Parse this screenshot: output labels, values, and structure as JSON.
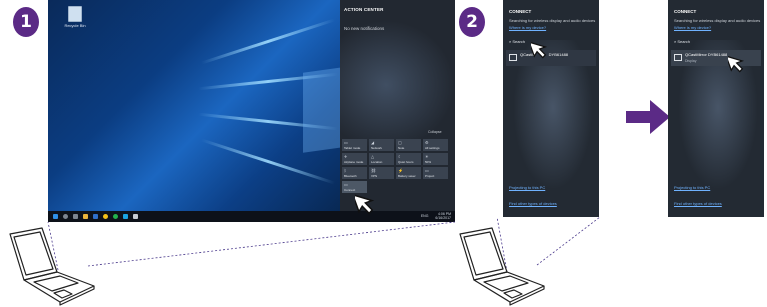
{
  "steps": {
    "one": "1",
    "two": "2"
  },
  "desktop": {
    "recycle_label": "Recycle Bin",
    "taskbar_time": "4:06 PM",
    "taskbar_date": "6/16/2017",
    "taskbar_lang": "ENG"
  },
  "action_center": {
    "title": "ACTION CENTER",
    "no_notifications": "No new notifications",
    "collapse": "Collapse",
    "tiles": [
      {
        "label": "Tablet mode",
        "icon": "tablet-mode-icon"
      },
      {
        "label": "Network",
        "icon": "network-icon"
      },
      {
        "label": "Note",
        "icon": "note-icon"
      },
      {
        "label": "All settings",
        "icon": "settings-icon"
      },
      {
        "label": "Airplane mode",
        "icon": "airplane-icon"
      },
      {
        "label": "Location",
        "icon": "location-icon"
      },
      {
        "label": "Quiet hours",
        "icon": "quiet-hours-icon"
      },
      {
        "label": "50%",
        "icon": "brightness-icon"
      },
      {
        "label": "Bluetooth",
        "icon": "bluetooth-icon"
      },
      {
        "label": "VPN",
        "icon": "vpn-icon"
      },
      {
        "label": "Battery saver",
        "icon": "battery-saver-icon"
      },
      {
        "label": "Project",
        "icon": "project-icon"
      },
      {
        "label": "Connect",
        "icon": "connect-icon"
      }
    ]
  },
  "connect_panel": {
    "title": "CONNECT",
    "subtitle": "Searching for wireless display and audio devices",
    "where_link": "Where is my device?",
    "search": "Search",
    "device_name": "QCastMirror DYB61488",
    "device_name_partial_a": "QCastM",
    "device_name_partial_b": "DYB61488",
    "device_type": "Display",
    "projecting_link": "Projecting to this PC",
    "find_other_link": "Find other types of devices"
  },
  "colors": {
    "badge": "#5b2a86",
    "arrow": "#5b2a86",
    "link": "#6fb2ff",
    "panel_bg": "#232a33"
  }
}
